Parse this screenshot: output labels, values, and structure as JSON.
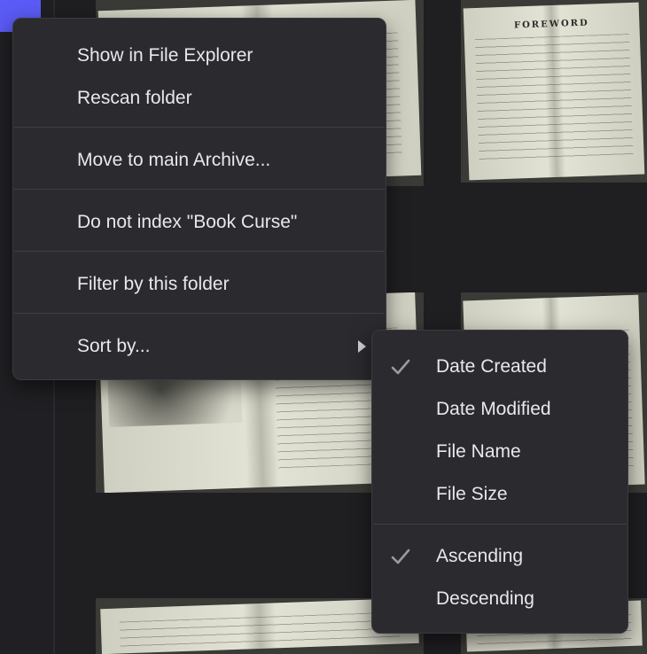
{
  "context_menu": {
    "items": [
      {
        "label": "Show in File Explorer"
      },
      {
        "label": "Rescan folder"
      },
      {
        "label": "Move to main Archive..."
      },
      {
        "label": "Do not index \"Book Curse\""
      },
      {
        "label": "Filter by this folder"
      },
      {
        "label": "Sort by..."
      }
    ]
  },
  "sort_submenu": {
    "fields": [
      {
        "label": "Date Created",
        "checked": true
      },
      {
        "label": "Date Modified",
        "checked": false
      },
      {
        "label": "File Name",
        "checked": false
      },
      {
        "label": "File Size",
        "checked": false
      }
    ],
    "order": [
      {
        "label": "Ascending",
        "checked": true
      },
      {
        "label": "Descending",
        "checked": false
      }
    ]
  },
  "background": {
    "thumbnail_title": "FOREWORD"
  },
  "colors": {
    "accent": "#5b5bf7",
    "menu_bg": "#2b2b2f",
    "menu_text": "#e8e8ec",
    "separator": "#3e3e44"
  }
}
